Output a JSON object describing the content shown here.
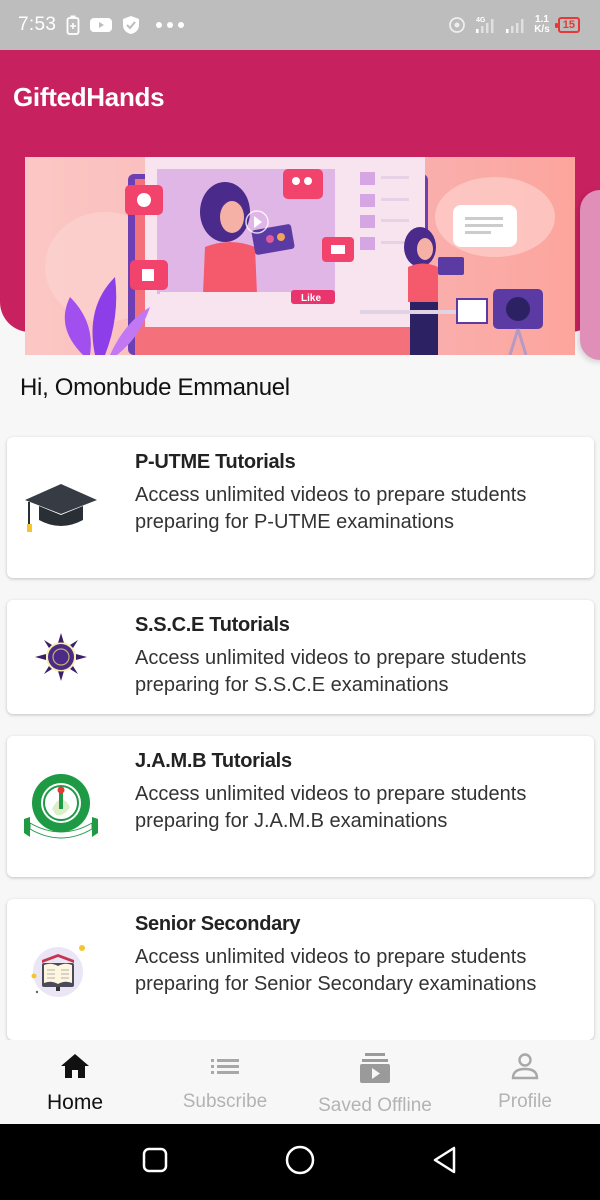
{
  "status_bar": {
    "time": "7:53",
    "left_icons": [
      "battery-saver-icon",
      "youtube-icon",
      "shield-check-icon",
      "more-dots-icon"
    ],
    "right_icons": [
      "hotspot-icon",
      "signal-4g-icon",
      "signal-icon"
    ],
    "network_type": "4G",
    "net_speed_value": "1.1",
    "net_speed_unit": "K/s",
    "battery_level": "15"
  },
  "header": {
    "app_title": "GiftedHands",
    "accent_color": "#c8215f"
  },
  "banner": {
    "like_label": "Like",
    "alt": "Online video tutorial illustration"
  },
  "greeting": "Hi, Omonbude Emmanuel",
  "cards": [
    {
      "title": "P-UTME Tutorials",
      "description": "Access unlimited videos to prepare students preparing for P-UTME examinations",
      "icon": "graduation-cap-icon"
    },
    {
      "title": "S.S.C.E Tutorials",
      "description": "Access unlimited videos to prepare students preparing for S.S.C.E examinations",
      "icon": "waec-logo-icon"
    },
    {
      "title": "J.A.M.B Tutorials",
      "description": "Access unlimited videos to prepare students preparing for J.A.M.B examinations",
      "icon": "jamb-logo-icon"
    },
    {
      "title": "Senior Secondary",
      "description": "Access unlimited videos to prepare students preparing for Senior Secondary examinations",
      "icon": "open-book-icon"
    }
  ],
  "bottom_nav": {
    "items": [
      {
        "label": "Home",
        "icon": "home-icon",
        "active": true
      },
      {
        "label": "Subscribe",
        "icon": "list-icon",
        "active": false
      },
      {
        "label": "Saved Offline",
        "icon": "video-library-icon",
        "active": false
      },
      {
        "label": "Profile",
        "icon": "person-icon",
        "active": false
      }
    ]
  },
  "system_nav": {
    "buttons": [
      "recents",
      "home",
      "back"
    ]
  }
}
